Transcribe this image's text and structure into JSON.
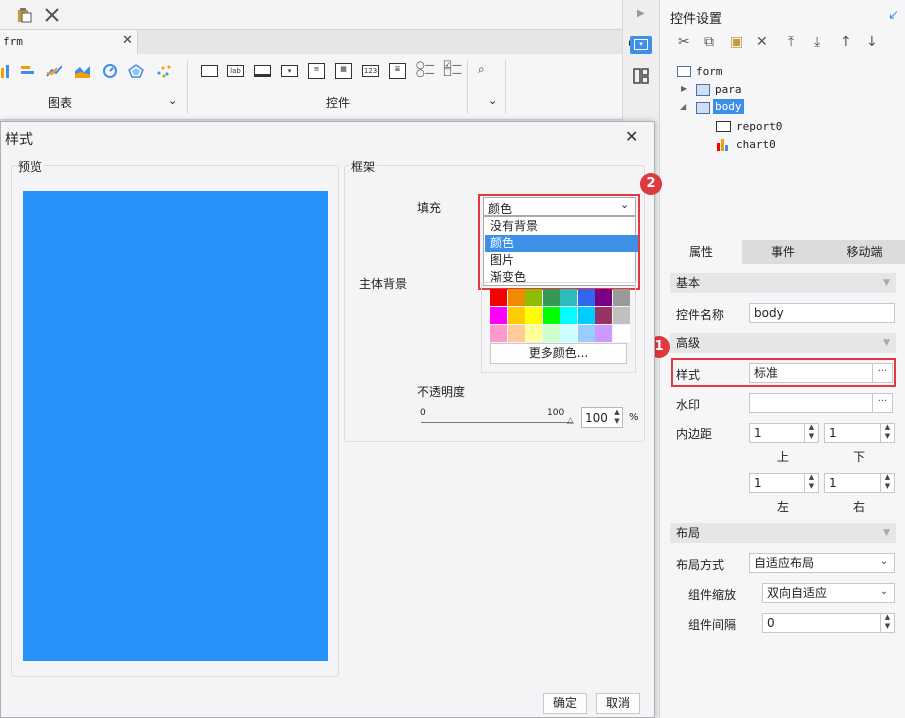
{
  "editor": {
    "tab_label": "frm",
    "chart_group_label": "图表",
    "control_group_label": "控件",
    "control_icon_lab": "lab",
    "control_icon_123": "123"
  },
  "right_panel": {
    "title": "控件设置",
    "tree": {
      "root": "form",
      "para": "para",
      "body": "body",
      "child1": "report0",
      "child2": "chart0"
    },
    "tabs": [
      "属性",
      "事件",
      "移动端"
    ],
    "sections": {
      "basic": "基本",
      "advanced": "高级",
      "layout": "布局"
    },
    "fields": {
      "name_label": "控件名称",
      "name_value": "body",
      "style_label": "样式",
      "style_value": "标准",
      "watermark_label": "水印",
      "watermark_value": "",
      "padding_label": "内边距",
      "pad_top": "1",
      "pad_bottom": "1",
      "pad_left": "1",
      "pad_right": "1",
      "top_label": "上",
      "bottom_label": "下",
      "left_label": "左",
      "right_label": "右",
      "layout_mode_label": "布局方式",
      "layout_mode_value": "自适应布局",
      "scale_label": "组件缩放",
      "scale_value": "双向自适应",
      "gap_label": "组件间隔",
      "gap_value": "0",
      "ellipsis": "···"
    }
  },
  "dialog": {
    "title": "样式",
    "preview_label": "预览",
    "frame_label": "框架",
    "fill_label": "填充",
    "fill_value": "颜色",
    "fill_options": [
      "没有背景",
      "颜色",
      "图片",
      "渐变色"
    ],
    "fill_selected_index": 1,
    "body_bg_label": "主体背景",
    "more_colors": "更多颜色...",
    "opacity_label": "不透明度",
    "slider_min": "0",
    "slider_max": "100",
    "opacity_value": "100",
    "percent": "%",
    "ok": "确定",
    "cancel": "取消",
    "preview_color": "#2893fb"
  },
  "palette": [
    [
      "#f30000",
      "#f18a00",
      "#8dbd00",
      "#339955",
      "#2ebbbb",
      "#3366ee",
      "#7b0088",
      "#999999"
    ],
    [
      "#ff00ff",
      "#ffcc00",
      "#ffff00",
      "#00ff00",
      "#00ffff",
      "#00ccff",
      "#993366",
      "#c0c0c0"
    ],
    [
      "#ff99cc",
      "#ffcc99",
      "#ffff99",
      "#ccffcc",
      "#ccffff",
      "#99ccff",
      "#cc99ff",
      "#ffffff"
    ]
  ],
  "badges": [
    "1",
    "2"
  ],
  "colors": {
    "accent": "#3d8fe8",
    "highlight": "#e0393e"
  }
}
